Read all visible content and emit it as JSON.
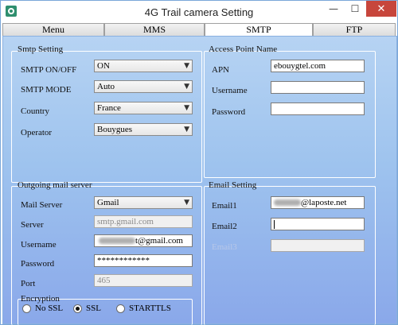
{
  "window": {
    "title": "4G Trail camera Setting",
    "minimize": "—",
    "maximize": "☐",
    "close": "✕"
  },
  "tabs": [
    "Menu",
    "MMS",
    "SMTP",
    "FTP"
  ],
  "active_tab": "SMTP",
  "smtp_setting": {
    "title": "Smtp Setting",
    "onoff_label": "SMTP ON/OFF",
    "onoff_value": "ON",
    "mode_label": "SMTP MODE",
    "mode_value": "Auto",
    "country_label": "Country",
    "country_value": "France",
    "operator_label": "Operator",
    "operator_value": "Bouygues"
  },
  "access_point": {
    "title": "Access Point Name",
    "apn_label": "APN",
    "apn_value": "ebouygtel.com",
    "username_label": "Username",
    "username_value": "",
    "password_label": "Password",
    "password_value": ""
  },
  "outgoing": {
    "title": "Outgoing mail server",
    "mail_server_label": "Mail Server",
    "mail_server_value": "Gmail",
    "server_label": "Server",
    "server_value": "smtp.gmail.com",
    "username_label": "Username",
    "username_suffix": "t@gmail.com",
    "password_label": "Password",
    "password_value": "************",
    "port_label": "Port",
    "port_value": "465",
    "encryption_label": "Encryption",
    "encryption_options": [
      "No SSL",
      "SSL",
      "STARTTLS"
    ],
    "encryption_selected": "SSL"
  },
  "email_setting": {
    "title": "Email Setting",
    "email1_label": "Email1",
    "email1_suffix": "@laposte.net",
    "email2_label": "Email2",
    "email2_value": "",
    "email3_label": "Email3",
    "email3_value": ""
  },
  "icons": {
    "app": "camera-app-icon",
    "dropdown": "chevron-down-icon"
  },
  "colors": {
    "close_button": "#c7463c",
    "panel_top": "#b6d3f3",
    "panel_bottom": "#8aa8ea"
  }
}
